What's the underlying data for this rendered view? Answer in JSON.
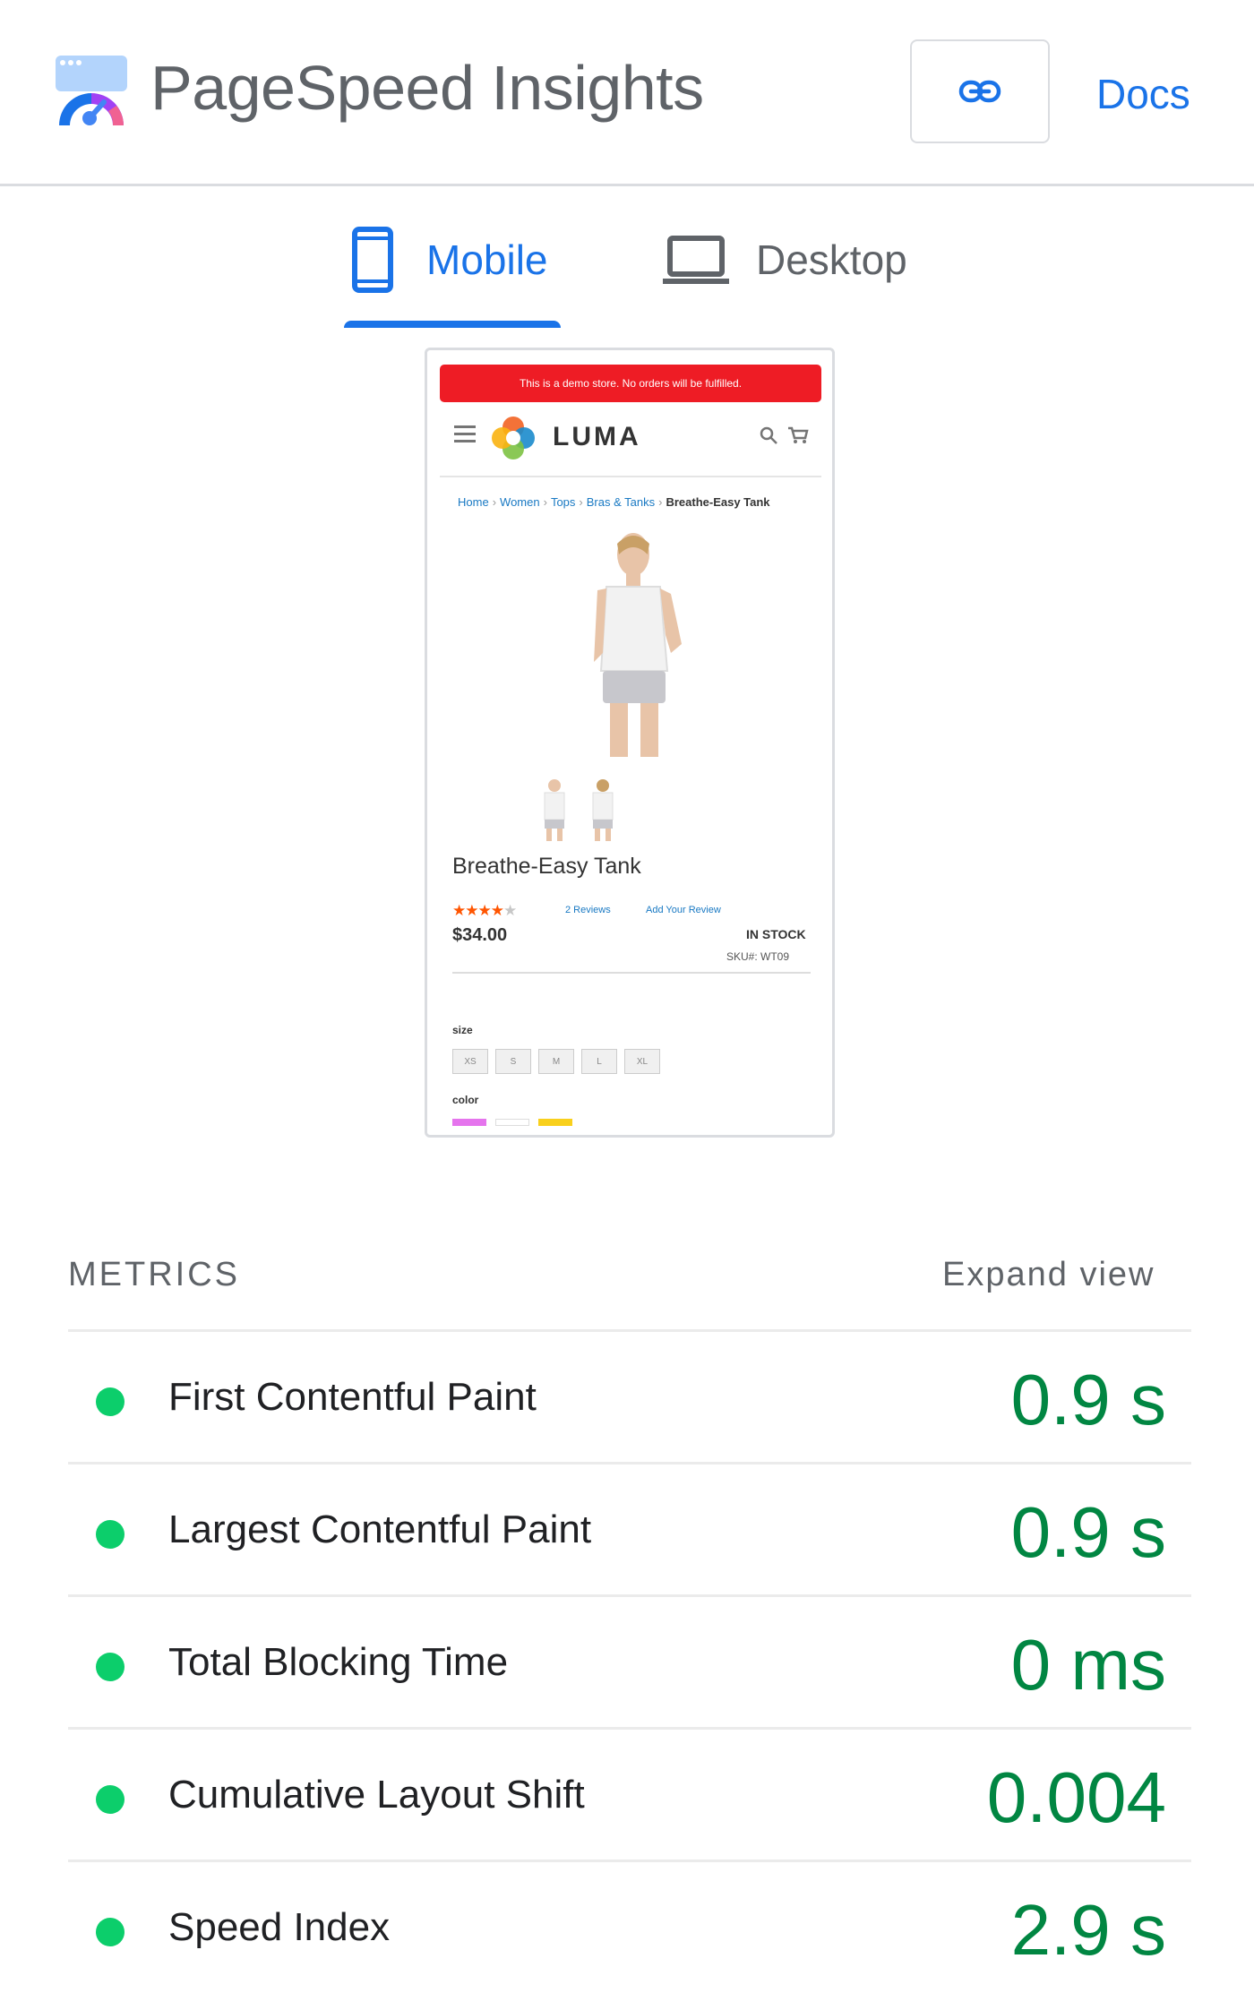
{
  "header": {
    "app_title": "PageSpeed Insights",
    "docs_label": "Docs",
    "link_icon": "link-icon"
  },
  "tabs": [
    {
      "label": "Mobile",
      "icon": "mobile-phone-icon",
      "selected": true
    },
    {
      "label": "Desktop",
      "icon": "laptop-icon",
      "selected": false
    }
  ],
  "screenshot": {
    "banner_text": "This is a demo store. No orders will be fulfilled.",
    "store_name": "LUMA",
    "breadcrumbs": [
      "Home",
      "Women",
      "Tops",
      "Bras & Tanks",
      "Breathe-Easy Tank"
    ],
    "product_name": "Breathe-Easy Tank",
    "rating_stars": 3.5,
    "rating_max": 5,
    "reviews_link": "2 Reviews",
    "add_review_link": "Add Your Review",
    "price": "$34.00",
    "stock": "IN STOCK",
    "sku": "SKU#:  WT09",
    "size_label": "size",
    "sizes": [
      "XS",
      "S",
      "M",
      "L",
      "XL"
    ],
    "color_label": "color",
    "colors": [
      "#e574ed",
      "#ffffff",
      "#f9d01c"
    ]
  },
  "metrics": {
    "heading": "METRICS",
    "expand_label": "Expand view",
    "status_color": "#0cce6b",
    "value_color": "#018642",
    "items": [
      {
        "name": "First Contentful Paint",
        "value": "0.9 s"
      },
      {
        "name": "Largest Contentful Paint",
        "value": "0.9 s"
      },
      {
        "name": "Total Blocking Time",
        "value": "0 ms"
      },
      {
        "name": "Cumulative Layout Shift",
        "value": "0.004"
      },
      {
        "name": "Speed Index",
        "value": "2.9 s"
      }
    ]
  }
}
